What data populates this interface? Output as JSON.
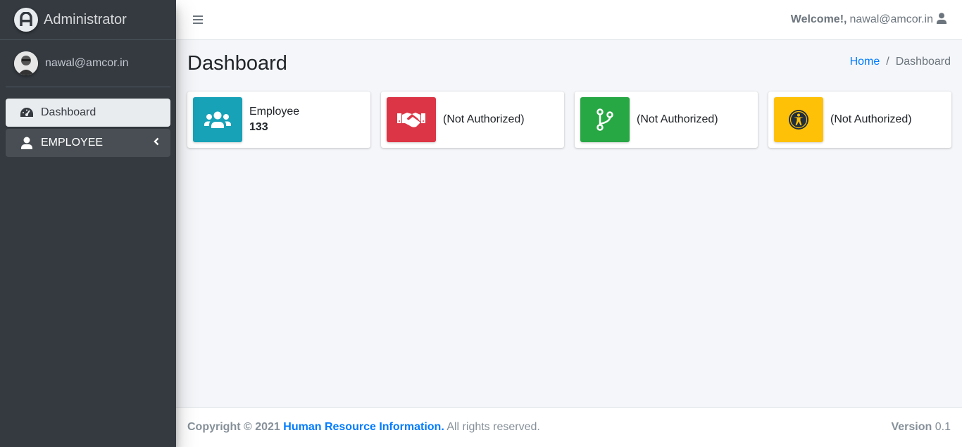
{
  "brand": {
    "title": "Administrator",
    "logo_icon": "logo-a-icon"
  },
  "user_panel": {
    "name": "nawal@amcor.in"
  },
  "sidebar": {
    "items": [
      {
        "label": "Dashboard",
        "icon": "tachometer-icon",
        "active": true
      },
      {
        "label": "EMPLOYEE",
        "icon": "user-icon",
        "expandable": true
      }
    ]
  },
  "header": {
    "welcome_label": "Welcome!,",
    "user_email": "nawal@amcor.in"
  },
  "page": {
    "title": "Dashboard"
  },
  "breadcrumb": {
    "home": "Home",
    "separator": "/",
    "current": "Dashboard"
  },
  "info_boxes": [
    {
      "label": "Employee",
      "value": "133",
      "color": "#17a2b8",
      "icon": "users-icon"
    },
    {
      "label": "(Not Authorized)",
      "color": "#dc3545",
      "icon": "handshake-icon"
    },
    {
      "label": "(Not Authorized)",
      "color": "#28a745",
      "icon": "code-branch-icon"
    },
    {
      "label": "(Not Authorized)",
      "color": "#ffc107",
      "icon": "universal-access-icon"
    }
  ],
  "footer": {
    "copyright": "Copyright © 2021",
    "org": "Human Resource Information.",
    "rights": "All rights reserved.",
    "version_label": "Version",
    "version_value": "0.1"
  },
  "colors": {
    "sidebar_bg": "#343a40",
    "link": "#007bff",
    "content_bg": "#f4f6f9"
  }
}
